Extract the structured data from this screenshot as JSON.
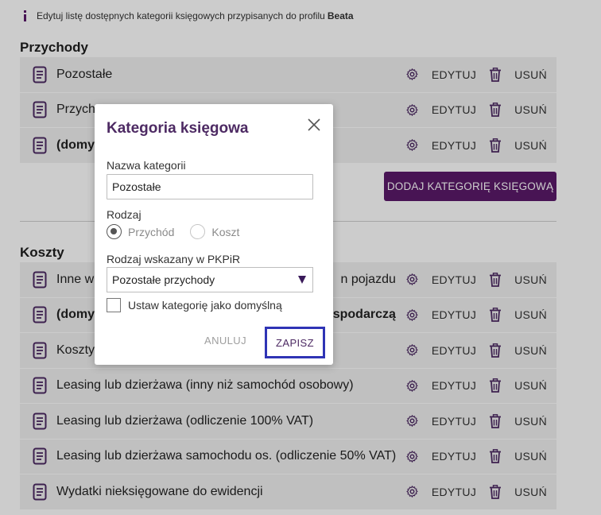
{
  "info": {
    "text": "Edytuj listę dostępnych kategorii księgowych przypisanych do profilu",
    "profile": "Beata"
  },
  "income": {
    "title": "Przychody",
    "rows": [
      {
        "name": "Pozostałe",
        "bold": false
      },
      {
        "name": "Przych",
        "bold": false
      },
      {
        "name": "(domy",
        "bold": true
      }
    ],
    "add_label": "DODAJ KATEGORIĘ KSIĘGOWĄ"
  },
  "costs": {
    "title": "Koszty",
    "rows": [
      {
        "name": "Inne w",
        "tail": "n pojazdu",
        "bold": false
      },
      {
        "name": "(domy",
        "tail": "ą gospodarczą",
        "bold": true
      },
      {
        "name": "Koszty",
        "tail": "",
        "bold": false
      },
      {
        "name": "Leasing lub dzierżawa (inny niż samochód osobowy)",
        "tail": "",
        "bold": false
      },
      {
        "name": "Leasing lub dzierżawa (odliczenie 100% VAT)",
        "tail": "",
        "bold": false
      },
      {
        "name": "Leasing lub dzierżawa samochodu os. (odliczenie 50% VAT)",
        "tail": "",
        "bold": false
      },
      {
        "name": "Wydatki nieksięgowane do ewidencji",
        "tail": "",
        "bold": false
      }
    ]
  },
  "actions": {
    "edit": "EDYTUJ",
    "delete": "USUŃ"
  },
  "modal": {
    "title": "Kategoria księgowa",
    "name_label": "Nazwa kategorii",
    "name_value": "Pozostałe",
    "type_label": "Rodzaj",
    "type_options": [
      "Przychód",
      "Koszt"
    ],
    "type_selected": "Przychód",
    "pkpir_label": "Rodzaj wskazany w PKPiR",
    "pkpir_value": "Pozostałe przychody",
    "default_label": "Ustaw kategorię jako domyślną",
    "default_checked": false,
    "cancel": "ANULUJ",
    "save": "ZAPISZ"
  },
  "colors": {
    "accent": "#5a1a6a",
    "title": "#4d2a63",
    "highlight": "#2f34b5"
  }
}
